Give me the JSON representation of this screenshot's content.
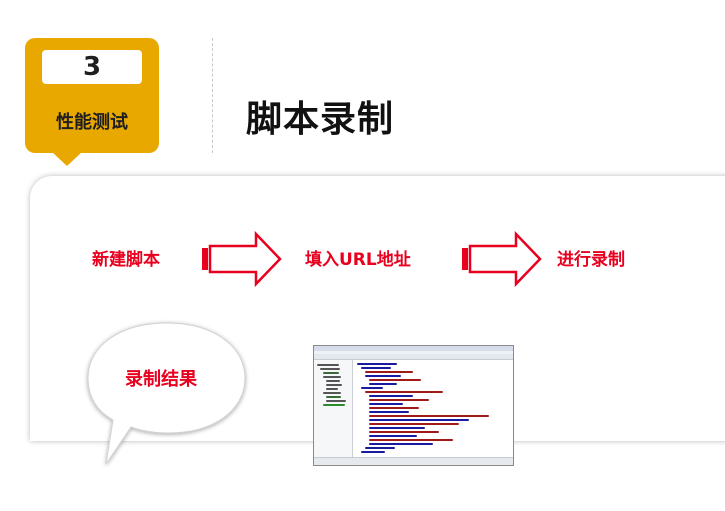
{
  "section": {
    "number": "3",
    "label": "性能测试"
  },
  "title": "脚本录制",
  "steps": [
    "新建脚本",
    "填入URL地址",
    "进行录制"
  ],
  "result": {
    "label": "录制结果"
  },
  "colors": {
    "badge": "#e8a800",
    "step_text": "#e8001f",
    "arrow": "#e8001f"
  },
  "icons": {
    "arrow": "right-arrow-icon",
    "bubble": "speech-bubble-icon"
  }
}
